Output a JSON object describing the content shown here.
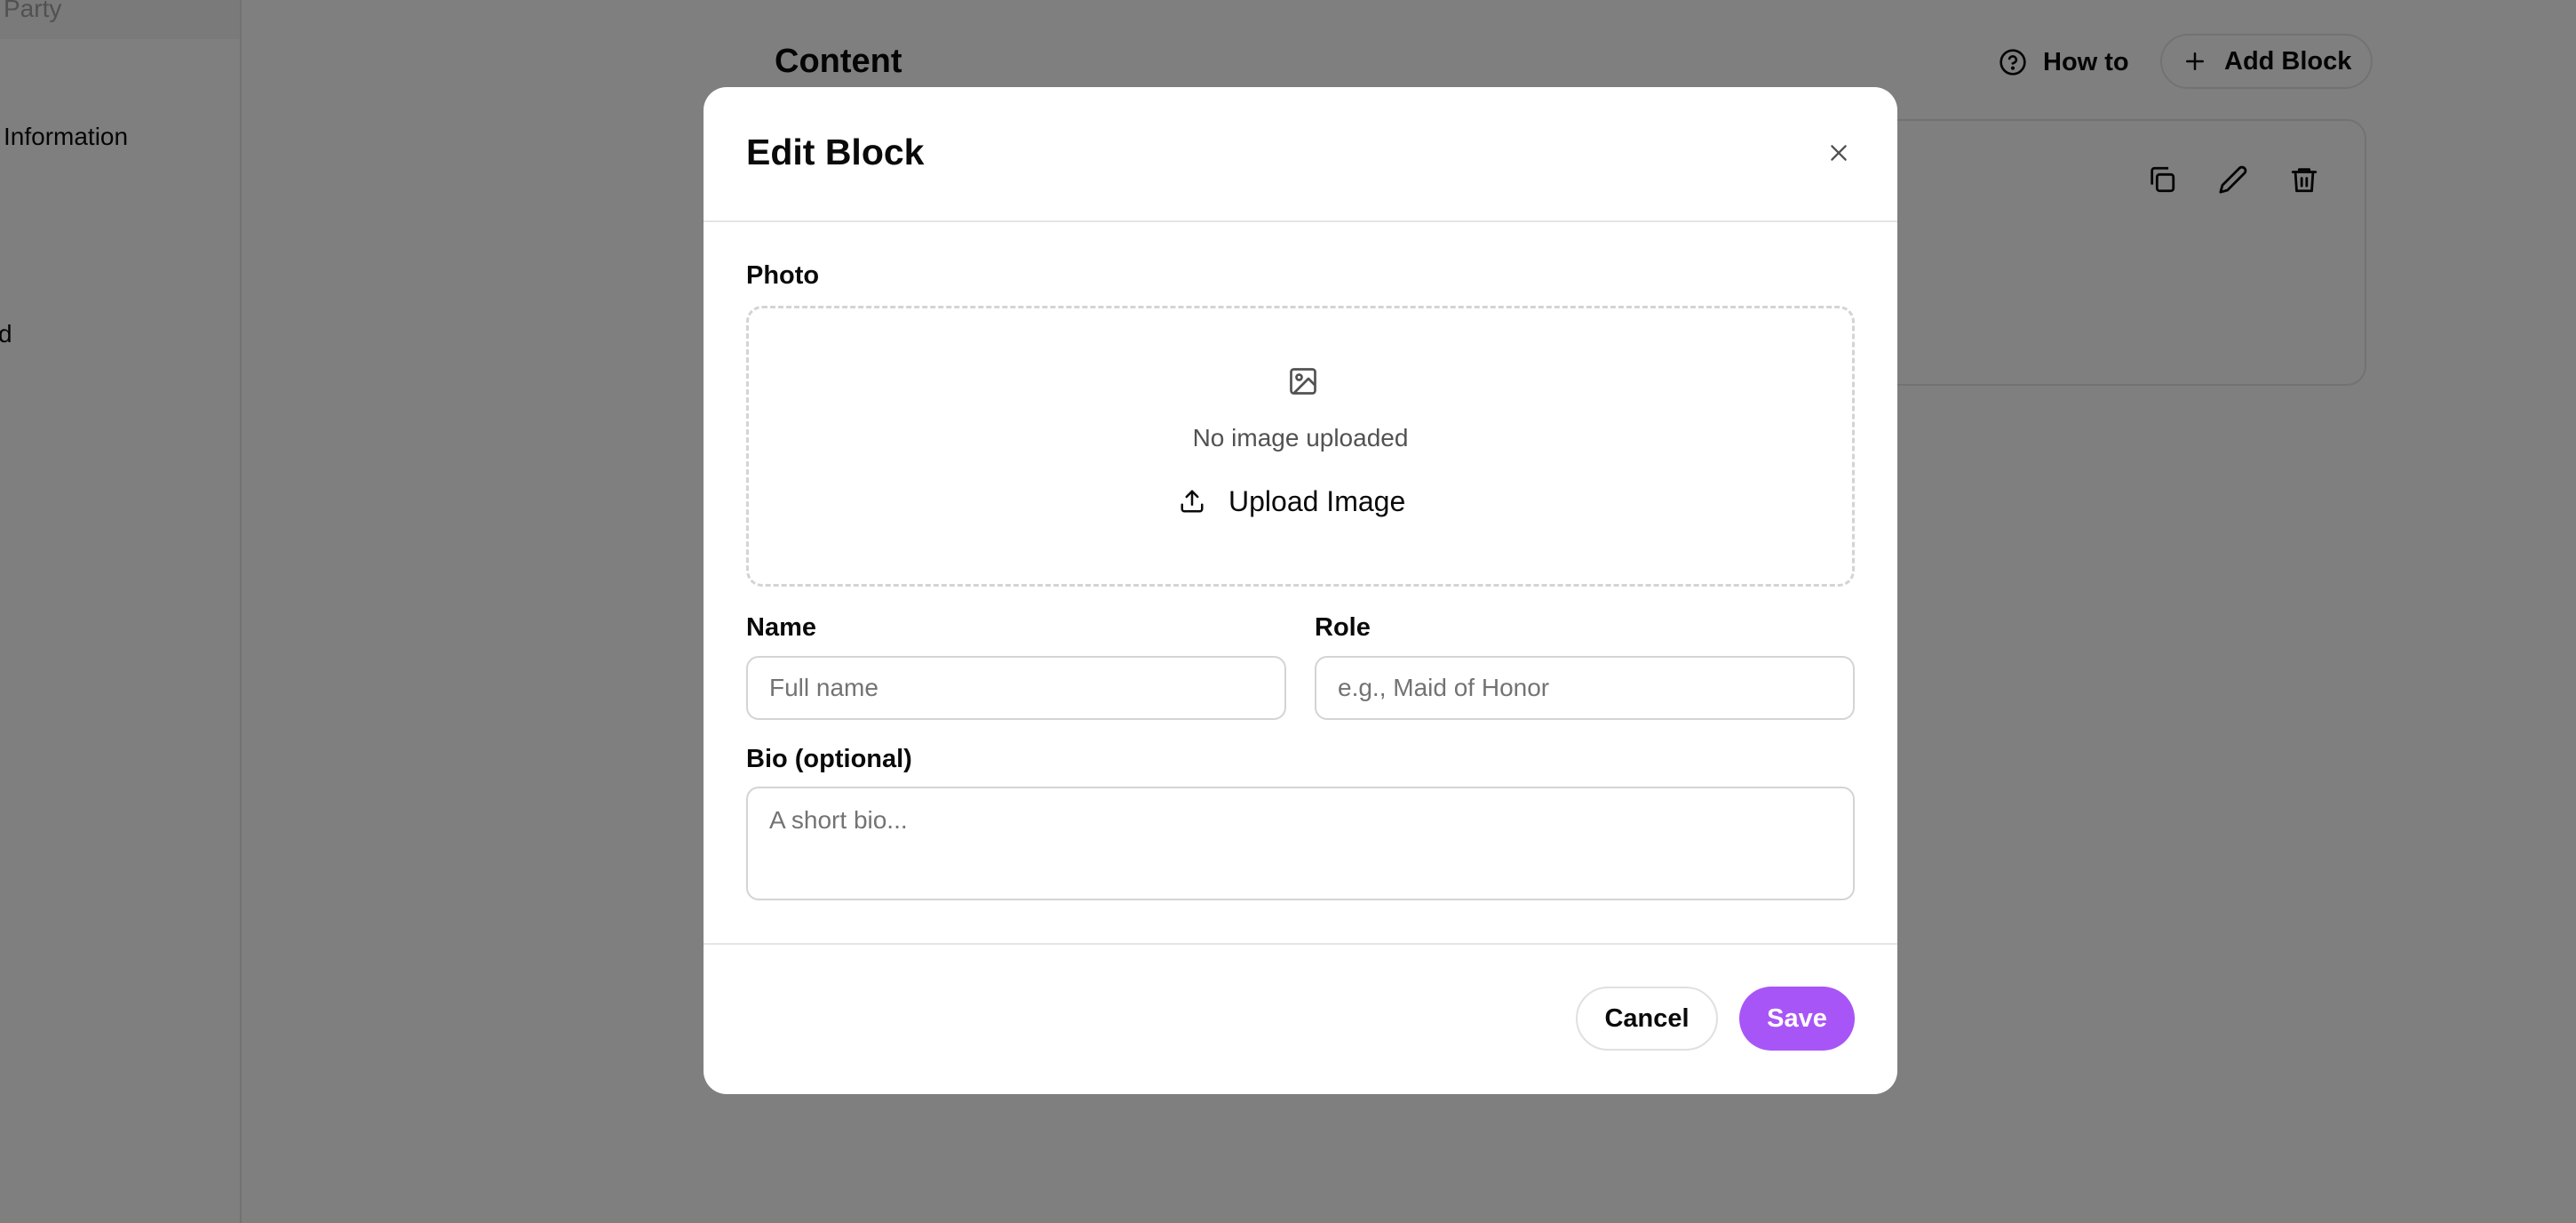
{
  "sidebar": {
    "items": [
      {
        "label": "Party"
      },
      {
        "label": "Information"
      },
      {
        "label": "d"
      }
    ]
  },
  "main": {
    "title": "Content",
    "how_to_label": "How to",
    "add_block_label": "Add Block"
  },
  "modal": {
    "title": "Edit Block",
    "photo": {
      "label": "Photo",
      "empty_text": "No image uploaded",
      "upload_label": "Upload Image"
    },
    "name": {
      "label": "Name",
      "value": "",
      "placeholder": "Full name"
    },
    "role": {
      "label": "Role",
      "value": "",
      "placeholder": "e.g., Maid of Honor"
    },
    "bio": {
      "label": "Bio (optional)",
      "value": "",
      "placeholder": "A short bio..."
    },
    "cancel_label": "Cancel",
    "save_label": "Save"
  },
  "colors": {
    "accent": "#a855f7",
    "overlay": "rgba(0,0,0,0.5)",
    "border": "#e5e5e5"
  },
  "icons": {
    "how_to": "help-circle-icon",
    "add_block": "plus-icon",
    "duplicate": "copy-icon",
    "edit": "pencil-icon",
    "delete": "trash-icon",
    "close": "close-icon",
    "image_placeholder": "image-icon",
    "upload": "upload-icon"
  }
}
